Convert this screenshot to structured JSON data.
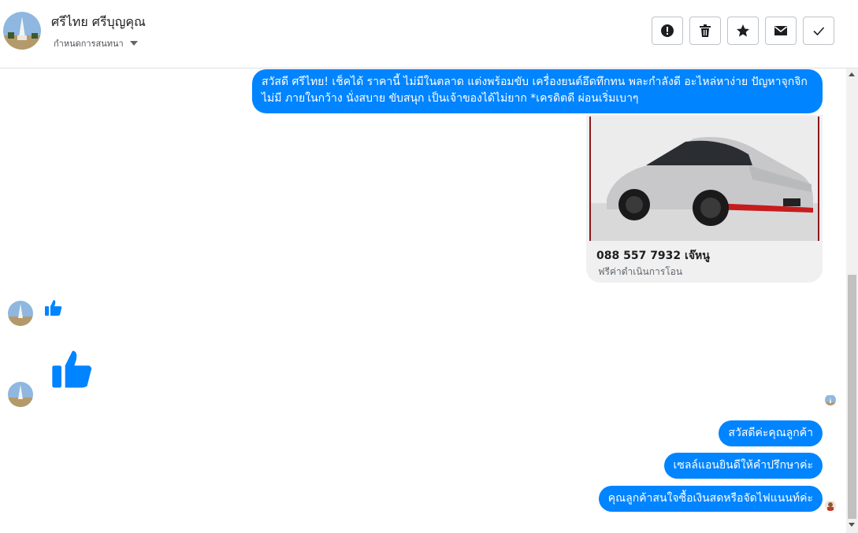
{
  "header": {
    "contact_name": "ศรีไทย ศรีบุญคุณ",
    "label_select": "กำหนดการสนทนา",
    "actions": [
      {
        "name": "report-spam-button",
        "icon": "exclamation-icon"
      },
      {
        "name": "delete-button",
        "icon": "trash-icon"
      },
      {
        "name": "star-button",
        "icon": "star-icon"
      },
      {
        "name": "mark-unread-button",
        "icon": "envelope-icon"
      },
      {
        "name": "mark-done-button",
        "icon": "checkmark-icon"
      }
    ]
  },
  "messages": {
    "intro_text": "สวัสดี ศรีไทย! เช็คได้ ราคานี้ ไม่มีในตลาด แต่งพร้อมขับ เครื่องยนต์อึดทึกทน พละกำลังดี อะไหล่หาง่าย ปัญหาจุกจิกไม่มี ภายในกว้าง นั่งสบาย ขับสนุก เป็นเจ้าของได้ไม่ยาก *เครดิตดี ผ่อนเริ่มเบาๆ",
    "card_title": "088 557 7932 เจ๊หนู",
    "card_subtitle": "ฟรีค่าดำเนินการโอน",
    "reply_1": "สวัสดีค่ะคุณลูกค้า",
    "reply_2": "เซลล์แอนยินดีให้คำปรึกษาค่ะ",
    "reply_3": "คุณลูกค้าสนใจซื้อเงินสดหรือจัดไฟแนนท์ค่ะ"
  },
  "colors": {
    "accent": "#0084ff",
    "header_border": "#dddfe2",
    "card_bg": "#f0f0f0"
  }
}
